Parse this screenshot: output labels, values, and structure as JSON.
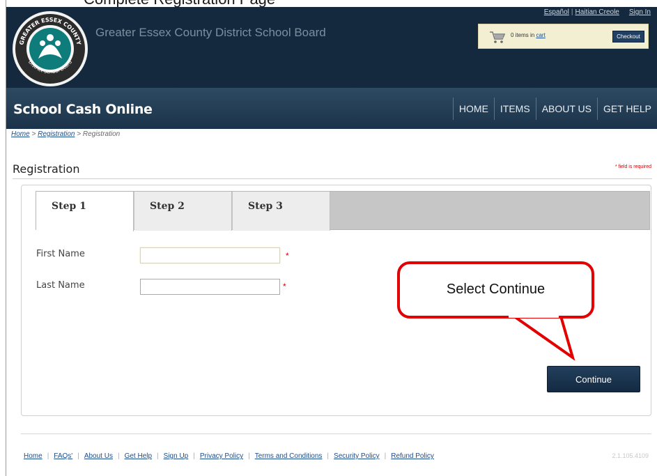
{
  "top_caption": "Complete Registration Page",
  "header": {
    "org_name": "Greater Essex County District School Board",
    "logo_text_top": "GREATER ESSEX COUNTY",
    "logo_text_bottom": "District School Board",
    "lang_links": [
      "Español",
      "Haitian Creole"
    ],
    "sign_in": "Sign In",
    "cart": {
      "prefix": "0 items in ",
      "link": "cart",
      "checkout_label": "Checkout"
    }
  },
  "nav": {
    "brand": "School Cash Online",
    "items": [
      "HOME",
      "ITEMS",
      "ABOUT US",
      "GET HELP"
    ]
  },
  "breadcrumb": {
    "home": "Home",
    "sep": " > ",
    "registration": "Registration",
    "current": "Registration"
  },
  "page": {
    "title": "Registration",
    "required_note_star": "*",
    "required_note": " field is required"
  },
  "tabs": [
    "Step 1",
    "Step 2",
    "Step 3"
  ],
  "form": {
    "first_name_label": "First Name",
    "first_name_value": "",
    "last_name_label": "Last Name",
    "last_name_value": "",
    "required_star": "*",
    "continue_label": "Continue"
  },
  "callout": {
    "text": "Select Continue",
    "color": "#e30000"
  },
  "footer": {
    "links": [
      "Home",
      "FAQs'",
      "About Us",
      "Get Help",
      "Sign Up",
      "Privacy Policy",
      "Terms and Conditions",
      "Security Policy",
      "Refund Policy"
    ],
    "version": "2.1.105.4109"
  }
}
